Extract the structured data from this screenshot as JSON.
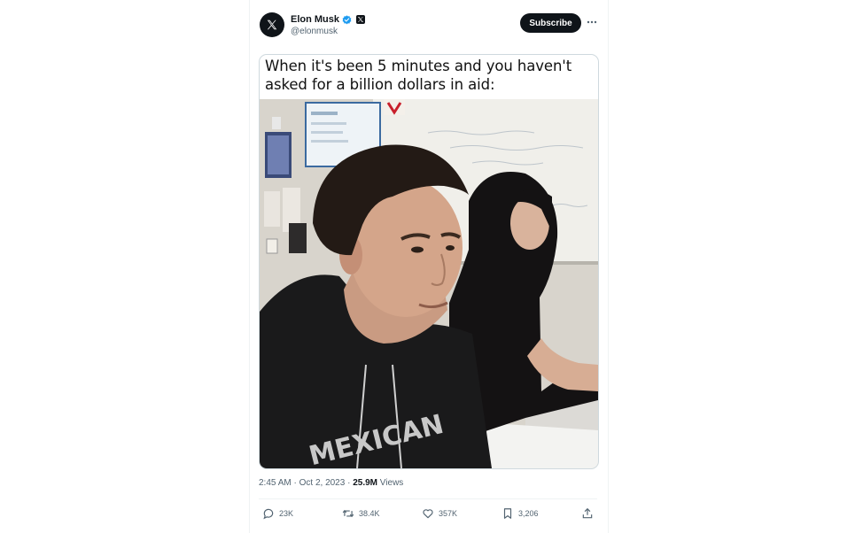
{
  "tweet": {
    "author": {
      "display_name": "Elon Musk",
      "handle": "@elonmusk",
      "verified": true,
      "affiliate_badge": "x-logo-icon",
      "avatar_icon": "x-logo-icon"
    },
    "subscribe_label": "Subscribe",
    "more_icon": "more-horizontal-icon",
    "media": {
      "caption": "When it's been 5 minutes and you haven't asked for a billion dollars in aid:",
      "shirt_text": "MEXICAN"
    },
    "meta": {
      "time": "2:45 AM",
      "separator": "·",
      "date": "Oct 2, 2023",
      "views_count": "25.9M",
      "views_label": "Views"
    },
    "actions": {
      "replies": "23K",
      "reposts": "38.4K",
      "likes": "357K",
      "bookmarks": "3,206"
    }
  },
  "colors": {
    "text_primary": "#0f1419",
    "text_secondary": "#536471",
    "verified_blue": "#1d9bf0",
    "border": "#cfd9de"
  }
}
